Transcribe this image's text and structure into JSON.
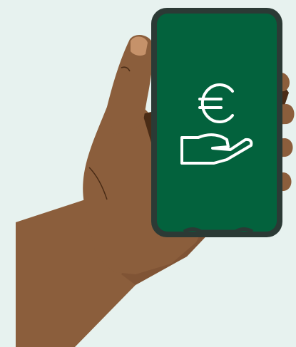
{
  "illustration": {
    "icons": [
      "euro-icon",
      "open-hand-icon"
    ]
  },
  "colors": {
    "background": "#E7F2EF",
    "skin": "#8B5E3C",
    "skin_shadow": "#6B4226",
    "skin_deep": "#4A2C16",
    "fingernail": "#C6926A",
    "phone_frame": "#2B3A35",
    "screen": "#03623D",
    "icon_stroke": "#FFFFFF"
  }
}
